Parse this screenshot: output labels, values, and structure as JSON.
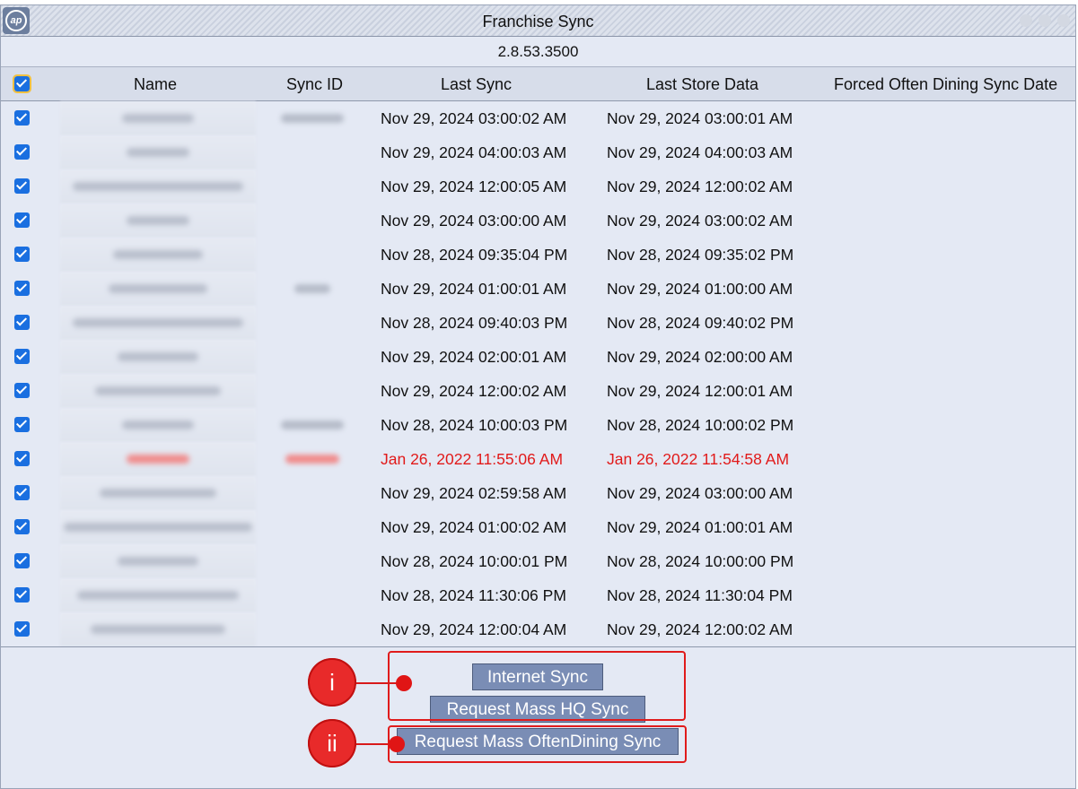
{
  "window": {
    "title": "Franchise Sync",
    "version": "2.8.53.3500",
    "logo_text": "ap"
  },
  "columns": {
    "name": "Name",
    "sync_id": "Sync ID",
    "last_sync": "Last Sync",
    "last_store_data": "Last Store Data",
    "forced": "Forced Often Dining Sync Date"
  },
  "rows": [
    {
      "last_sync": "Nov 29, 2024 03:00:02 AM",
      "last_store": "Nov 29, 2024 03:00:01 AM"
    },
    {
      "last_sync": "Nov 29, 2024 04:00:03 AM",
      "last_store": "Nov 29, 2024 04:00:03 AM"
    },
    {
      "last_sync": "Nov 29, 2024 12:00:05 AM",
      "last_store": "Nov 29, 2024 12:00:02 AM"
    },
    {
      "last_sync": "Nov 29, 2024 03:00:00 AM",
      "last_store": "Nov 29, 2024 03:00:02 AM"
    },
    {
      "last_sync": "Nov 28, 2024 09:35:04 PM",
      "last_store": "Nov 28, 2024 09:35:02 PM"
    },
    {
      "last_sync": "Nov 29, 2024 01:00:01 AM",
      "last_store": "Nov 29, 2024 01:00:00 AM"
    },
    {
      "last_sync": "Nov 28, 2024 09:40:03 PM",
      "last_store": "Nov 28, 2024 09:40:02 PM"
    },
    {
      "last_sync": "Nov 29, 2024 02:00:01 AM",
      "last_store": "Nov 29, 2024 02:00:00 AM"
    },
    {
      "last_sync": "Nov 29, 2024 12:00:02 AM",
      "last_store": "Nov 29, 2024 12:00:01 AM"
    },
    {
      "last_sync": "Nov 28, 2024 10:00:03 PM",
      "last_store": "Nov 28, 2024 10:00:02 PM"
    },
    {
      "last_sync": "Jan 26, 2022 11:55:06 AM",
      "last_store": "Jan 26, 2022 11:54:58 AM"
    },
    {
      "last_sync": "Nov 29, 2024 02:59:58 AM",
      "last_store": "Nov 29, 2024 03:00:00 AM"
    },
    {
      "last_sync": "Nov 29, 2024 01:00:02 AM",
      "last_store": "Nov 29, 2024 01:00:01 AM"
    },
    {
      "last_sync": "Nov 28, 2024 10:00:01 PM",
      "last_store": "Nov 28, 2024 10:00:00 PM"
    },
    {
      "last_sync": "Nov 28, 2024 11:30:06 PM",
      "last_store": "Nov 28, 2024 11:30:04 PM"
    },
    {
      "last_sync": "Nov 29, 2024 12:00:04 AM",
      "last_store": "Nov 29, 2024 12:00:02 AM"
    }
  ],
  "buttons": {
    "internet_sync": "Internet Sync",
    "mass_hq": "Request Mass HQ Sync",
    "mass_often": "Request Mass OftenDining Sync"
  },
  "annotations": {
    "marker_1": "i",
    "marker_2": "ii"
  },
  "colors": {
    "checkbox": "#1a6fe0",
    "stale_text": "#e11a1a",
    "button": "#7a8db5",
    "annotation": "#e01b1b"
  },
  "icons": {
    "logo": "ap-logo-icon",
    "window_controls": "window-control-icon"
  }
}
